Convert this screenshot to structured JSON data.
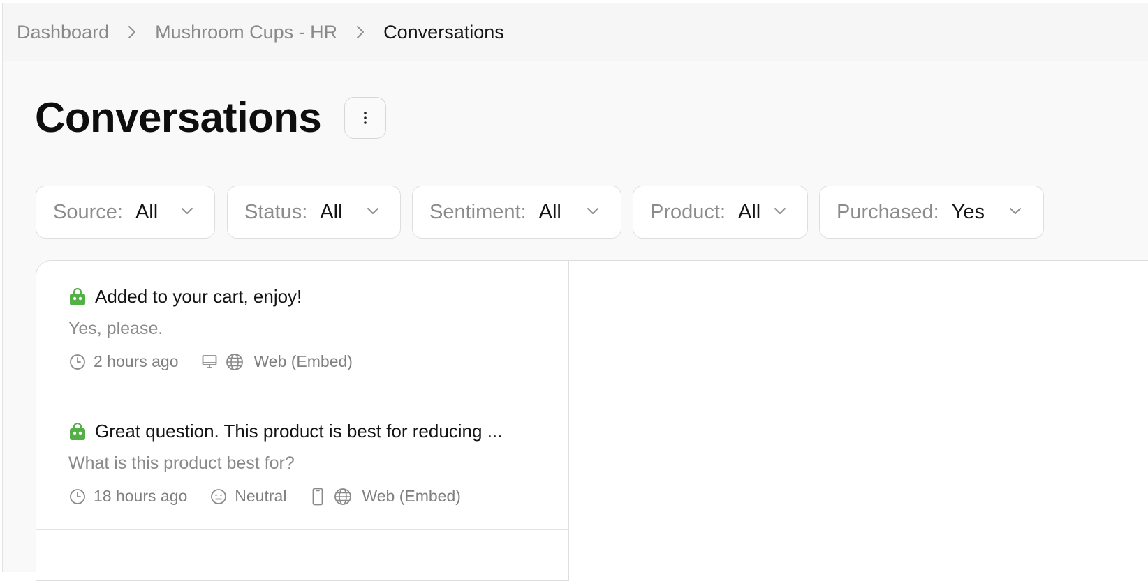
{
  "breadcrumb": {
    "items": [
      "Dashboard",
      "Mushroom Cups - HR",
      "Conversations"
    ]
  },
  "page": {
    "title": "Conversations",
    "more_icon": "vertical-ellipsis-icon"
  },
  "filters": [
    {
      "label": "Source:",
      "value": "All"
    },
    {
      "label": "Status:",
      "value": "All"
    },
    {
      "label": "Sentiment:",
      "value": "All"
    },
    {
      "label": "Product:",
      "value": "All"
    },
    {
      "label": "Purchased:",
      "value": "Yes"
    }
  ],
  "conversations": [
    {
      "reply": "Added to your cart, enjoy!",
      "message": "Yes, please.",
      "time": "2 hours ago",
      "sentiment": "",
      "device": "desktop-icon",
      "source": "Web (Embed)"
    },
    {
      "reply": "Great question. This product is best for reducing ...",
      "message": "What is this product best for?",
      "time": "18 hours ago",
      "sentiment": "Neutral",
      "device": "mobile-icon",
      "source": "Web (Embed)"
    }
  ],
  "colors": {
    "bot_icon": "#53b046",
    "muted_text": "#8a8a8a",
    "border": "#dedede"
  }
}
